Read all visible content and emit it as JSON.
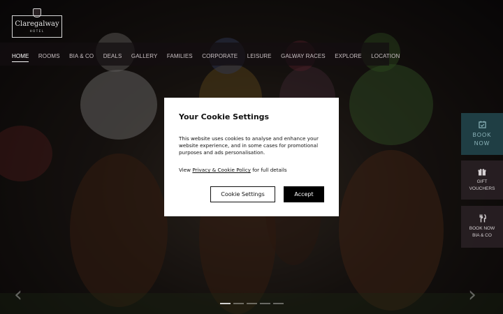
{
  "logo": {
    "name": "Claregalway",
    "sub": "HOTEL"
  },
  "nav": {
    "items": [
      {
        "label": "HOME",
        "active": true
      },
      {
        "label": "ROOMS",
        "active": false
      },
      {
        "label": "BIA & CO",
        "active": false
      },
      {
        "label": "DEALS",
        "active": false
      },
      {
        "label": "GALLERY",
        "active": false
      },
      {
        "label": "FAMILIES",
        "active": false
      },
      {
        "label": "CORPORATE",
        "active": false
      },
      {
        "label": "LEISURE",
        "active": false
      },
      {
        "label": "GALWAY RACES",
        "active": false
      },
      {
        "label": "EXPLORE",
        "active": false
      },
      {
        "label": "LOCATION",
        "active": false
      }
    ]
  },
  "side": {
    "book": {
      "line1": "BOOK",
      "line2": "NOW",
      "icon": "calendar-icon"
    },
    "gift": {
      "line1": "GIFT",
      "line2": "VOUCHERS",
      "icon": "gift-icon"
    },
    "bia": {
      "line1": "BOOK NOW",
      "line2": "BIA & CO",
      "icon": "cutlery-icon"
    }
  },
  "slider": {
    "prev": "‹",
    "next": "›",
    "dots": 5,
    "active_dot": 0
  },
  "cookie": {
    "title": "Your Cookie Settings",
    "body": "This website uses cookies to analyse and enhance your website experience, and in some cases for promotional purposes and ads personalisation.",
    "view_prefix": "View ",
    "link": "Privacy & Cookie Policy",
    "view_suffix": " for full details",
    "settings_button": "Cookie Settings",
    "accept_button": "Accept"
  },
  "colors": {
    "book_bg": "#1f3e44",
    "book_text": "#8fb7bd",
    "accept_bg": "#000000"
  }
}
